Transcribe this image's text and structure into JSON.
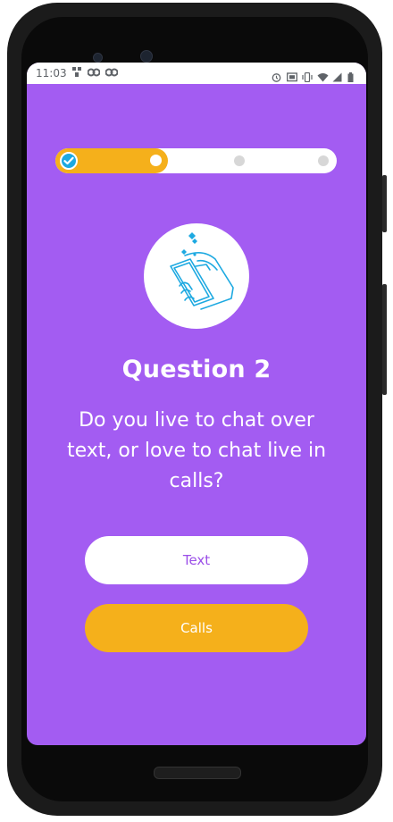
{
  "status_bar": {
    "time": "11:03",
    "left_icons": [
      "grid-notification-icon",
      "ds-notification-icon",
      "ds-notification-icon"
    ],
    "right_icons": [
      "alarm-icon",
      "cast-icon",
      "vibrate-icon",
      "wifi-icon",
      "signal-icon",
      "battery-icon"
    ]
  },
  "progress": {
    "total_steps": 4,
    "completed_steps": 1,
    "current_step": 2,
    "fill_fraction": 0.4
  },
  "illustration": {
    "icon": "hand-holding-phone-hearts-icon",
    "accent_color": "#1da9e1"
  },
  "quiz": {
    "title": "Question 2",
    "question": "Do you live to chat over text, or love to chat live in calls?"
  },
  "answers": {
    "text_label": "Text",
    "calls_label": "Calls"
  },
  "colors": {
    "background": "#a35cf2",
    "accent": "#f5b01b",
    "white": "#ffffff",
    "text_button_label": "#9b4fe8"
  }
}
